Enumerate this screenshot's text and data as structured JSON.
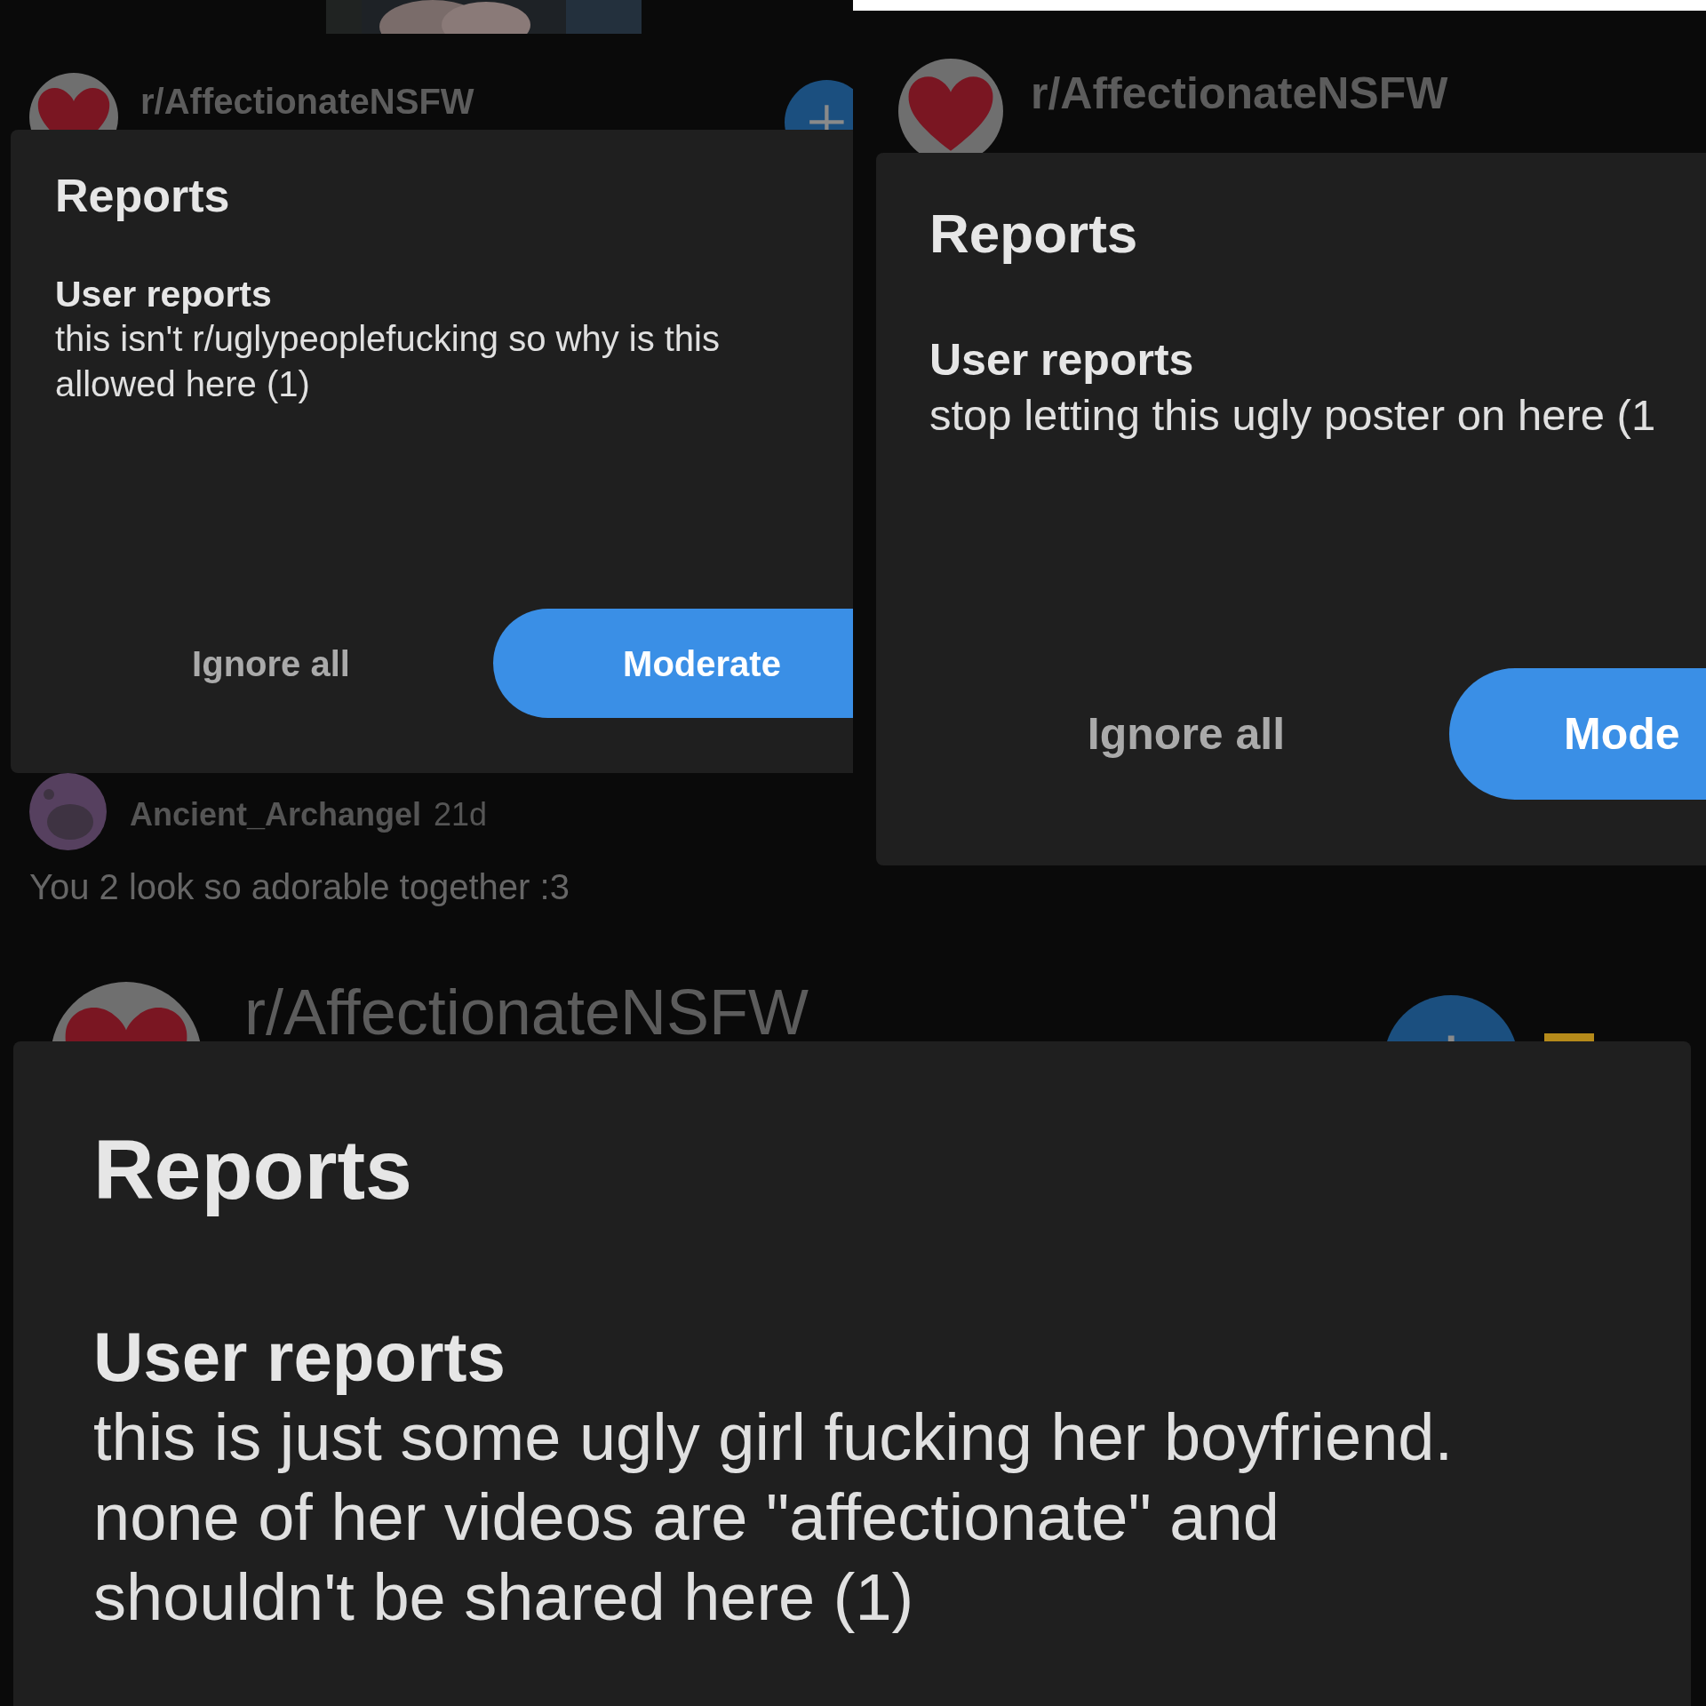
{
  "panels": [
    {
      "header": {
        "subreddit": "r/AffectionateNSFW"
      },
      "dialog": {
        "title": "Reports",
        "section": "User reports",
        "report": "this isn't r/uglypeoplefucking so why is this allowed here (1)",
        "buttons": [
          {
            "label": "Ignore all",
            "kind": "secondary"
          },
          {
            "label": "Moderate",
            "kind": "primary"
          }
        ]
      },
      "comment": {
        "author": "Ancient_Archangel",
        "age": "21d",
        "text": "You 2 look so adorable together :3"
      }
    },
    {
      "header": {
        "subreddit": "r/AffectionateNSFW"
      },
      "dialog": {
        "title": "Reports",
        "section": "User reports",
        "report": "stop letting this ugly poster on here (1",
        "buttons": [
          {
            "label": "Ignore all",
            "kind": "secondary"
          },
          {
            "label": "Mode",
            "kind": "primary"
          }
        ]
      }
    },
    {
      "header": {
        "subreddit": "r/AffectionateNSFW"
      },
      "dialog": {
        "title": "Reports",
        "section": "User reports",
        "report": "this is just some ugly girl fucking her boyfriend. none of her videos are \"affectionate\" and shouldn't be shared here (1)"
      }
    }
  ]
}
